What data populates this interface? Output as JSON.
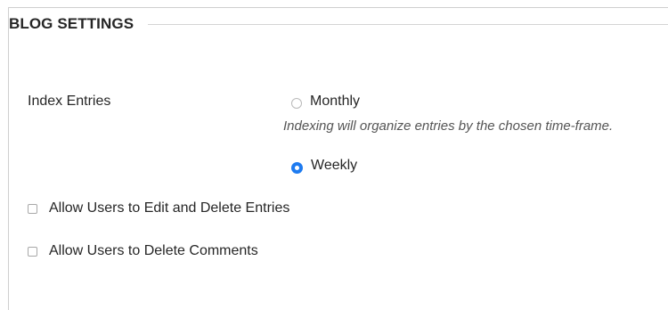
{
  "section": {
    "title": "BLOG SETTINGS"
  },
  "index_entries": {
    "label": "Index Entries",
    "options": [
      {
        "label": "Monthly",
        "checked": false
      },
      {
        "label": "Weekly",
        "checked": true
      }
    ],
    "help": "Indexing will organize entries by the chosen time-frame."
  },
  "permissions": {
    "allow_edit_delete_entries": {
      "label": "Allow Users to Edit and Delete Entries",
      "checked": false
    },
    "allow_delete_comments": {
      "label": "Allow Users to Delete Comments",
      "checked": false
    }
  },
  "colors": {
    "accent": "#1e7bf0",
    "border": "#cfcfcf",
    "text": "#262626",
    "help_text": "#555555"
  }
}
